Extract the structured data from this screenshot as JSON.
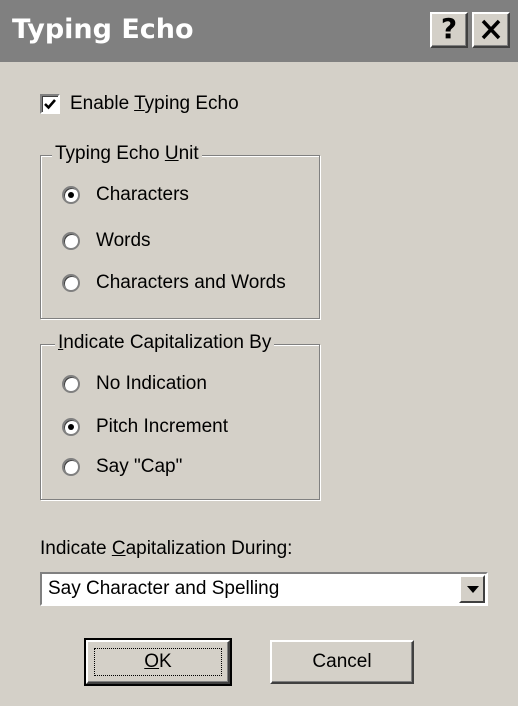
{
  "window": {
    "title": "Typing Echo",
    "help_glyph": "?",
    "close_glyph": "✕"
  },
  "enable_typing_echo": {
    "label_prefix": "Enable ",
    "label_mnemonic": "T",
    "label_suffix": "yping Echo",
    "checked": true,
    "check_glyph": "✔"
  },
  "typing_echo_unit": {
    "legend_prefix": "Typing Echo ",
    "legend_mnemonic": "U",
    "legend_suffix": "nit",
    "options": [
      {
        "label": "Characters",
        "selected": true
      },
      {
        "label": "Words",
        "selected": false
      },
      {
        "label": "Characters and Words",
        "selected": false
      }
    ]
  },
  "indicate_capitalization_by": {
    "legend_mnemonic": "I",
    "legend_suffix": "ndicate Capitalization By",
    "options": [
      {
        "label": "No Indication",
        "selected": false
      },
      {
        "label": "Pitch Increment",
        "selected": true
      },
      {
        "label": "Say \"Cap\"",
        "selected": false
      }
    ]
  },
  "capitalization_during": {
    "label_prefix": "Indicate ",
    "label_mnemonic": "C",
    "label_suffix": "apitalization During:",
    "selected_value": "Say Character and Spelling"
  },
  "buttons": {
    "ok_mnemonic": "O",
    "ok_suffix": "K",
    "cancel_label": "Cancel"
  }
}
